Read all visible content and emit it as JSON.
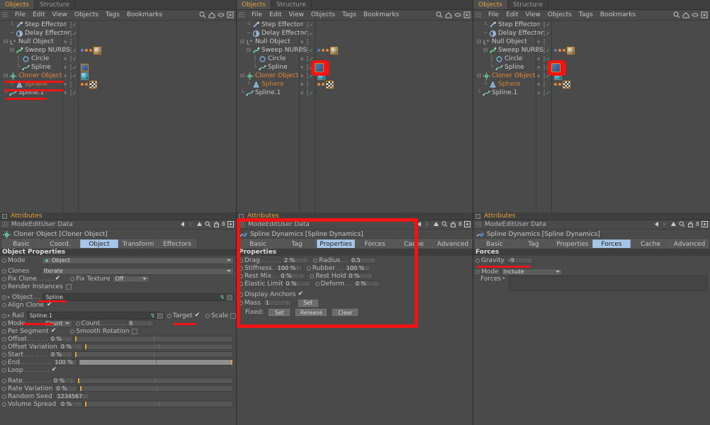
{
  "object_manager": {
    "tabs": [
      {
        "label": "Objects",
        "active": true
      },
      {
        "label": "Structure",
        "active": false
      }
    ],
    "menu": [
      "File",
      "Edit",
      "View",
      "Objects",
      "Tags",
      "Bookmarks"
    ],
    "icons": [
      "search-icon",
      "home-icon",
      "ellipse-icon",
      "plus-box-icon"
    ],
    "rows": [
      {
        "name": "Step Effector",
        "icon": "step-effector-icon",
        "indent": 1,
        "tree": "└",
        "expander": "",
        "selected": false,
        "check": true,
        "tags": []
      },
      {
        "name": "Delay Effector",
        "icon": "delay-effector-icon",
        "indent": 1,
        "tree": "─",
        "expander": "",
        "selected": false,
        "check": true,
        "tags": []
      },
      {
        "name": "Null Object",
        "icon": "null-object-icon",
        "indent": 0,
        "tree": "",
        "expander": "-",
        "selected": false,
        "check": false,
        "tags": []
      },
      {
        "name": "Sweep NURBS",
        "icon": "sweep-nurbs-icon",
        "indent": 1,
        "tree": "",
        "expander": "-",
        "selected": false,
        "check": true,
        "tags": [
          "dot-blue",
          "dot-orange",
          "dot-orange",
          "sphere-material"
        ]
      },
      {
        "name": "Circle",
        "icon": "circle-spline-icon",
        "indent": 2,
        "tree": "│",
        "expander": "",
        "selected": false,
        "check": true,
        "tags": []
      },
      {
        "name": "Spline",
        "icon": "spline-icon",
        "indent": 2,
        "tree": "└",
        "expander": "",
        "selected": false,
        "check": true,
        "tags": [
          "spline-dynamics-tag"
        ]
      },
      {
        "name": "Cloner Object",
        "icon": "cloner-object-icon",
        "indent": 0,
        "tree": "",
        "expander": "-",
        "selected": true,
        "check": true,
        "tags": [
          "teal-sphere-material"
        ]
      },
      {
        "name": "Sphere",
        "icon": "sphere-icon",
        "indent": 1,
        "tree": "└",
        "expander": "",
        "selected": true,
        "check": false,
        "tags": [
          "dot-orange",
          "dot-orange",
          "checker-material"
        ]
      },
      {
        "name": "Spline.1",
        "icon": "spline-icon",
        "indent": 0,
        "tree": "└",
        "expander": "",
        "selected": false,
        "check": true,
        "tags": []
      }
    ]
  },
  "attributes_common": {
    "title": "Attributes",
    "menu": [
      "Mode",
      "Edit",
      "User Data"
    ],
    "icons": [
      "back-arrow-icon",
      "forward-arrow-icon",
      "up-arrow-icon",
      "search-icon",
      "lock-icon",
      "history-count-icon",
      "plus-box-icon"
    ],
    "history_count": "8"
  },
  "panel_left": {
    "object_header": "Cloner Object [Cloner Object]",
    "object_icon": "cloner-object-icon",
    "tabs": [
      {
        "label": "Basic",
        "active": false
      },
      {
        "label": "Coord.",
        "active": false
      },
      {
        "label": "Object",
        "active": true
      },
      {
        "label": "Transform",
        "active": false
      },
      {
        "label": "Effectors",
        "active": false
      }
    ],
    "group_title": "Object Properties",
    "mode_label": "Mode",
    "mode_value": "Object",
    "clones_label": "Clones",
    "clones_value": "Iterate",
    "fix_clone_label": "Fix Clone",
    "fix_clone_checked": true,
    "fix_texture_label": "Fix Texture",
    "fix_texture_value": "Off",
    "render_instances_label": "Render Instances",
    "render_instances_checked": false,
    "object_label": "Object",
    "object_value": "Spline",
    "align_clone_label": "Align Clone",
    "align_clone_checked": true,
    "rail_label": "Rail",
    "rail_value": "Spline.1",
    "target_label": "Target",
    "target_checked": true,
    "scale_label": "Scale",
    "scale_checked": false,
    "mode2_label": "Mode",
    "mode2_value": "Count",
    "count_label": "Count",
    "count_value": "8",
    "per_segment_label": "Per Segment",
    "per_segment_checked": true,
    "smooth_rotation_label": "Smooth Rotation",
    "smooth_rotation_checked": false,
    "sliders": [
      {
        "label": "Offset",
        "value": "0 %",
        "fill": 0
      },
      {
        "label": "Offset Variation",
        "value": "0 %",
        "fill": 0
      },
      {
        "label": "Start",
        "value": "0 %",
        "fill": 0
      },
      {
        "label": "End",
        "value": "100 %",
        "fill": 100
      }
    ],
    "loop_label": "Loop",
    "loop_checked": true,
    "sliders2": [
      {
        "label": "Rate",
        "value": "0 %",
        "fill": 0
      },
      {
        "label": "Rate Variation",
        "value": "0 %",
        "fill": 0
      }
    ],
    "random_seed_label": "Random Seed",
    "random_seed_value": "1234567",
    "volume_spread_label": "Volume Spread",
    "volume_spread_value": "0 %"
  },
  "panel_mid": {
    "object_header": "Spline Dynamics [Spline Dynamics]",
    "object_icon": "spline-dynamics-icon",
    "tabs": [
      {
        "label": "Basic",
        "active": false
      },
      {
        "label": "Tag",
        "active": false
      },
      {
        "label": "Properties",
        "active": true
      },
      {
        "label": "Forces",
        "active": false
      },
      {
        "label": "Cache",
        "active": false
      },
      {
        "label": "Advanced",
        "active": false
      }
    ],
    "group_title": "Properties",
    "fields": [
      {
        "label": "Drag",
        "value": "2 %",
        "label2": "Radius",
        "value2": "0.5"
      },
      {
        "label": "Stiffness",
        "value": "100 %",
        "label2": "Rubber",
        "value2": "100 %"
      },
      {
        "label": "Rest Mix",
        "value": "0 %",
        "label2": "Rest Hold",
        "value2": "0 %"
      },
      {
        "label": "Elastic Limit",
        "value": "0 %",
        "label2": "Deform",
        "value2": "0 %"
      }
    ],
    "display_anchors_label": "Display Anchors",
    "display_anchors_checked": true,
    "mass_label": "Mass",
    "mass_value": "1",
    "mass_set_label": "Set",
    "fixed_label": "Fixed:",
    "fixed_buttons": [
      "Set",
      "Release",
      "Clear"
    ]
  },
  "panel_right": {
    "object_header": "Spline Dynamics [Spline Dynamics]",
    "object_icon": "spline-dynamics-icon",
    "tabs": [
      {
        "label": "Basic",
        "active": false
      },
      {
        "label": "Tag",
        "active": false
      },
      {
        "label": "Properties",
        "active": false
      },
      {
        "label": "Forces",
        "active": true
      },
      {
        "label": "Cache",
        "active": false
      },
      {
        "label": "Advanced",
        "active": false
      }
    ],
    "group_title": "Forces",
    "gravity_label": "Gravity",
    "gravity_value": "-9",
    "mode_label": "Mode",
    "mode_value": "Include",
    "forces_label": "Forces"
  },
  "annotations": {
    "color": "#f01414",
    "notes": [
      "underline-spline-row-left",
      "underline-cloner-object-row-left",
      "underline-sphere-row-left",
      "underline-spline1-row-left",
      "highlight-spline-dynamics-tag-mid",
      "highlight-spline-dynamics-tag-right",
      "underline-object-spline-value",
      "underline-rail-spline1-value",
      "underline-target-checkbox",
      "box-properties-panel-mid",
      "underline-gravity-value-right"
    ]
  }
}
